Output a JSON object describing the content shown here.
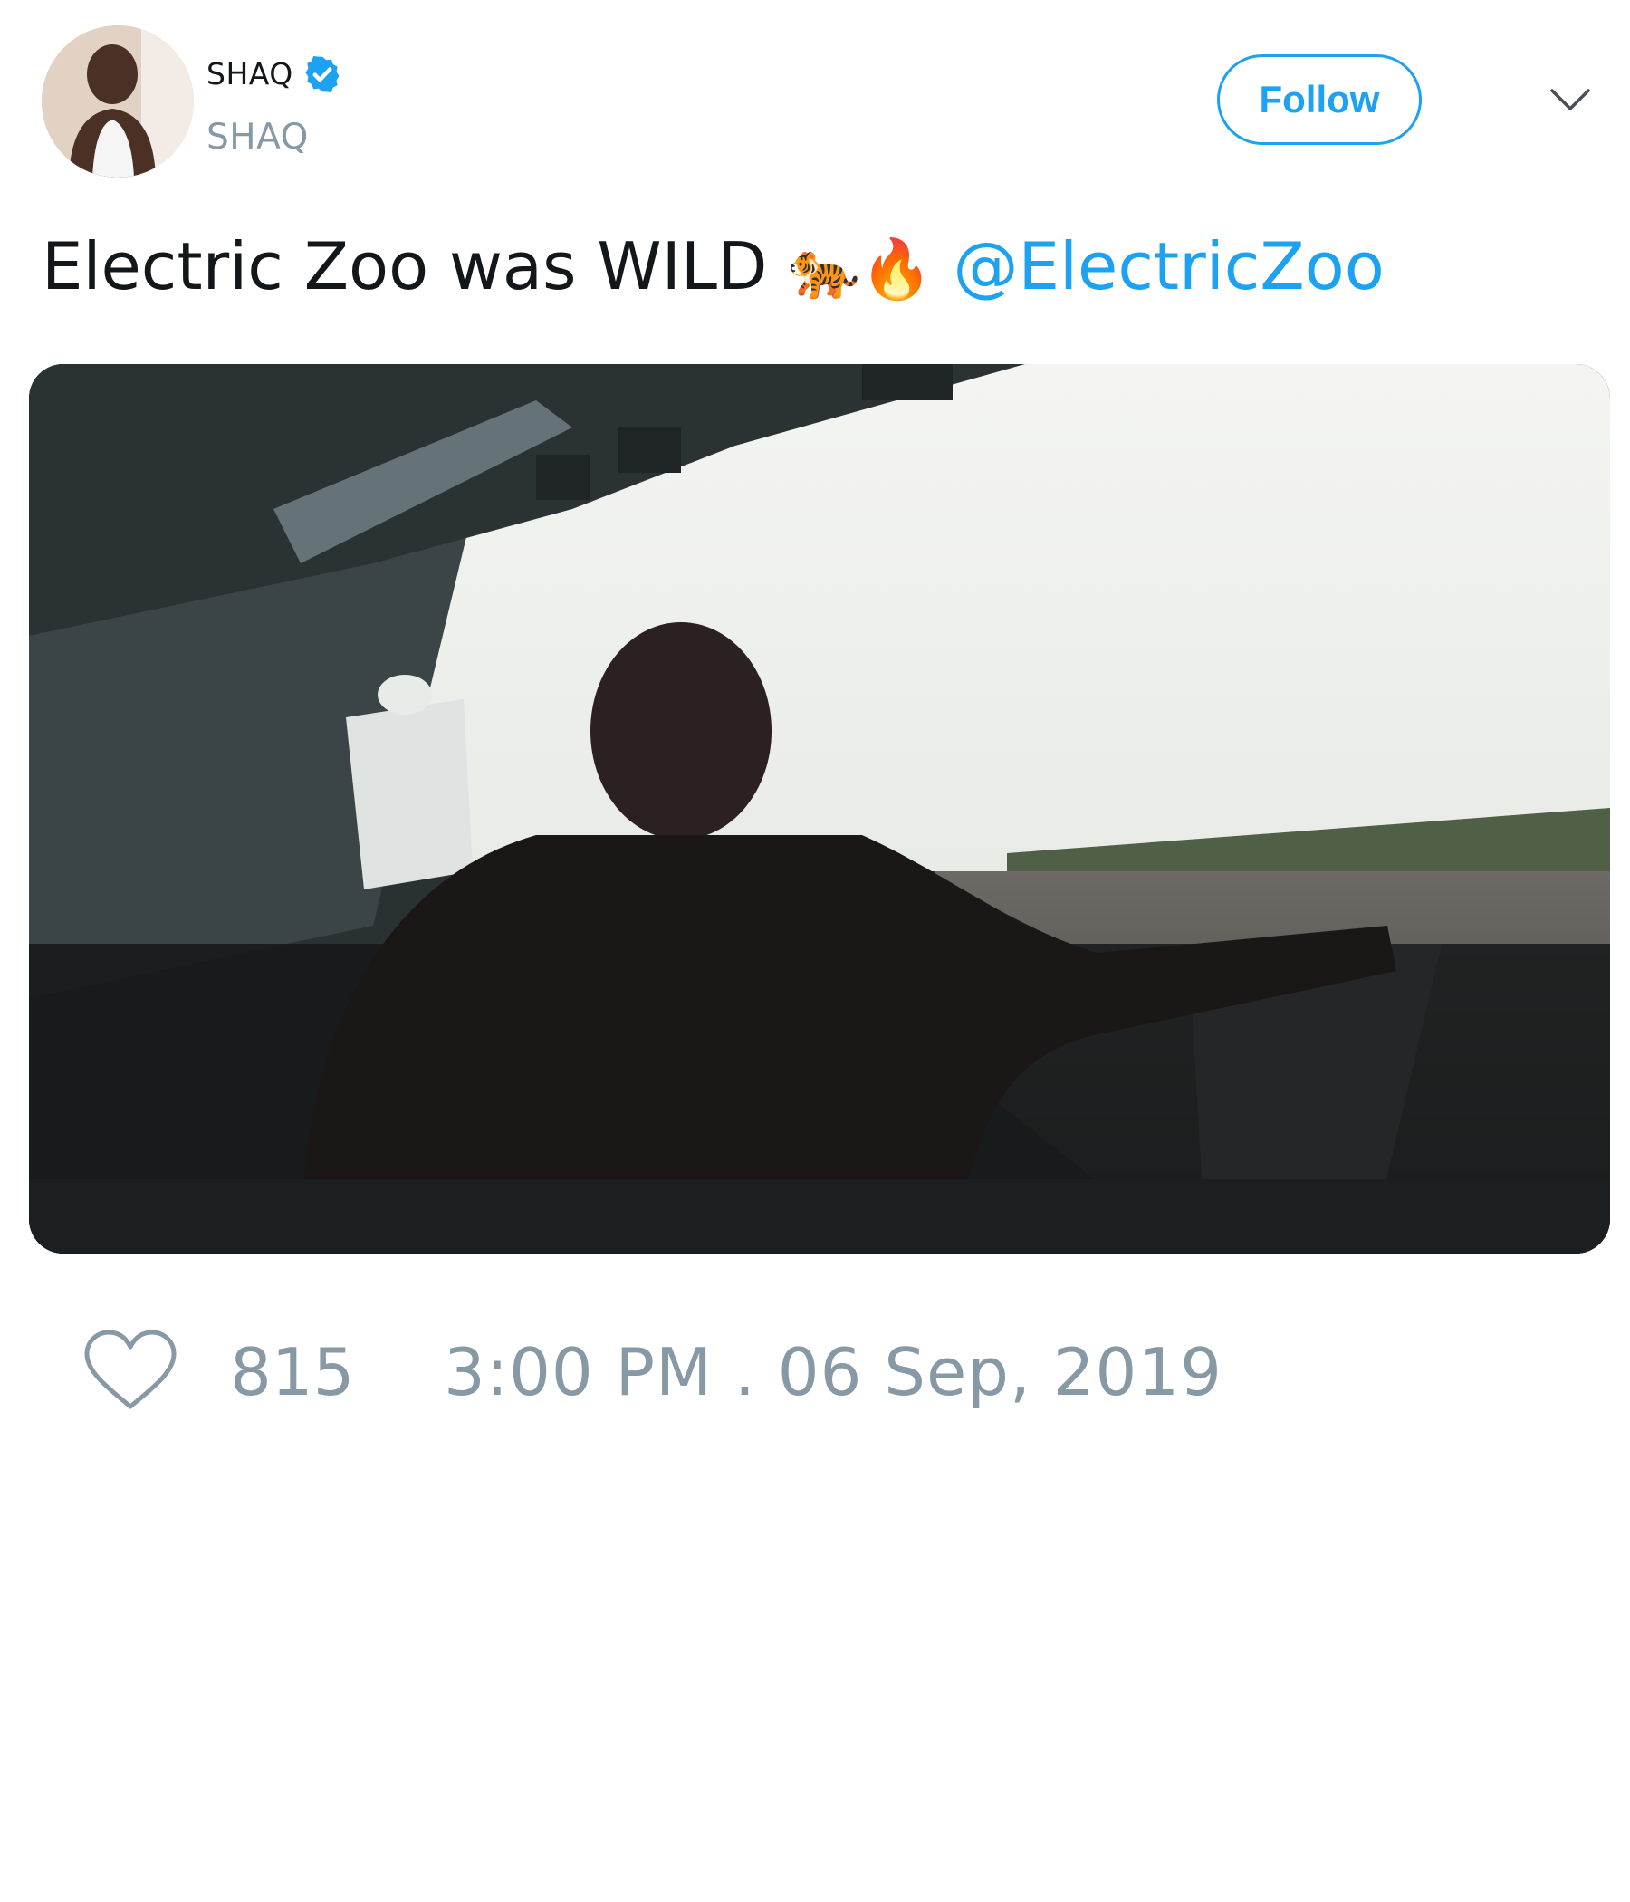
{
  "tweet": {
    "author": {
      "display_name": "SHAQ",
      "handle": "SHAQ",
      "verified": true
    },
    "follow_label": "Follow",
    "text": "Electric Zoo was WILD",
    "emojis": "🐅🔥",
    "mention": "@ElectricZoo",
    "likes": "815",
    "timestamp": "3:00 PM . 06 Sep, 2019"
  },
  "icons": {
    "verified": "verified-badge-icon",
    "menu": "chevron-down-icon",
    "like": "heart-icon"
  },
  "colors": {
    "accent": "#1da1f2",
    "muted": "#8899a6",
    "text": "#14171a"
  }
}
